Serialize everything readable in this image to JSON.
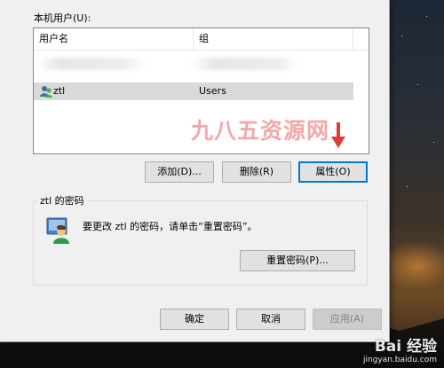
{
  "local_users_label": "本机用户(U):",
  "list": {
    "columns": [
      "用户名",
      "组"
    ],
    "rows": [
      {
        "name": "",
        "group": "",
        "blurred": true
      },
      {
        "name": "ztl",
        "group": "Users",
        "blurred": false,
        "selected": true
      }
    ]
  },
  "watermark_text": "九八五资源网",
  "buttons": {
    "add": "添加(D)...",
    "remove": "删除(R)",
    "properties": "属性(O)",
    "reset_password": "重置密码(P)...",
    "ok": "确定",
    "cancel": "取消",
    "apply": "应用(A)"
  },
  "password_group": {
    "title": "ztl 的密码",
    "message": "要更改 ztl 的密码，请单击“重置密码”。"
  },
  "baidu_watermark": {
    "main": "Bai 经验",
    "sub": "jingyan.baidu.com"
  },
  "colors": {
    "accent": "#0078d7",
    "selection": "#d9d9d9",
    "arrow": "#e53935",
    "watermark": "#eb5f5f"
  },
  "icons": [
    "user-icon",
    "user-password-icon",
    "red-down-arrow-icon"
  ]
}
